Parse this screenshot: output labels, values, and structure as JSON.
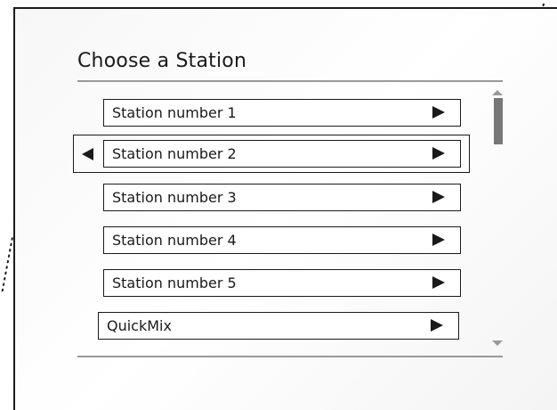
{
  "screen": {
    "title": "Choose a Station"
  },
  "stations": [
    {
      "label": "Station number 1"
    },
    {
      "label": "Station number 2"
    },
    {
      "label": "Station number 3"
    },
    {
      "label": "Station number 4"
    },
    {
      "label": "Station number 5"
    },
    {
      "label": "QuickMix"
    }
  ],
  "selected_index": 1,
  "icons": {
    "play": "play-arrow-icon",
    "back": "back-arrow-icon",
    "scroll_up": "scroll-up-icon",
    "scroll_down": "scroll-down-icon"
  },
  "colors": {
    "text": "#1a1a1a",
    "rule": "#999999",
    "scroll_thumb": "#777777"
  }
}
